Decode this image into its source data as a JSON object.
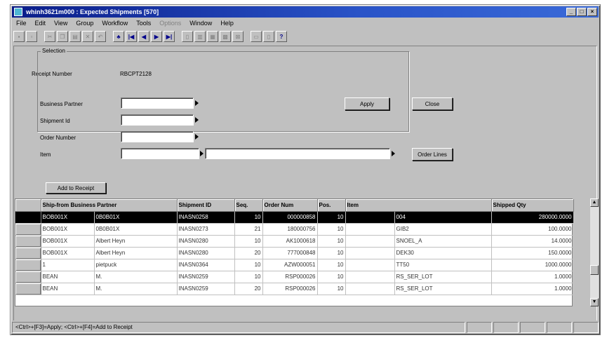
{
  "window": {
    "title": "whinh3621m000 : Expected Shipments [570]",
    "btn_min": "_",
    "btn_max": "□",
    "btn_close": "×"
  },
  "menu": {
    "file": "File",
    "edit": "Edit",
    "view": "View",
    "group": "Group",
    "workflow": "Workflow",
    "tools": "Tools",
    "disabled": "Options",
    "window": "Window",
    "help": "Help"
  },
  "form": {
    "receipt_label": "Receipt Number",
    "receipt_value": "RBCPT2128",
    "selection_label": "Selection",
    "bp_label": "Business Partner",
    "shipment_label": "Shipment Id",
    "order_label": "Order Number",
    "item_label": "Item",
    "apply": "Apply",
    "close": "Close",
    "order_lines": "Order Lines",
    "add_to_receipt": "Add to Receipt"
  },
  "grid": {
    "headers": {
      "bp": "Ship-from Business Partner",
      "shipment": "Shipment ID",
      "seq": "Seq.",
      "order": "Order Num",
      "pos": "Pos.",
      "item": "Item",
      "qty": "Shipped Qty"
    },
    "rows": [
      {
        "bp": "BOB001X",
        "bp_name": "0B0B01X",
        "shipment": "INASN0258",
        "seq": "10",
        "order": "000000858",
        "pos": "10",
        "item": "004",
        "qty": "280000.0000"
      },
      {
        "bp": "BOB001X",
        "bp_name": "0B0B01X",
        "shipment": "INASN0273",
        "seq": "21",
        "order": "180000756",
        "pos": "10",
        "item": "GIB2",
        "qty": "100.0000"
      },
      {
        "bp": "BOB001X",
        "bp_name": "Albert Heyn",
        "shipment": "INASN0280",
        "seq": "10",
        "order": "AK1000618",
        "pos": "10",
        "item": "SNOEL_A",
        "qty": "14.0000"
      },
      {
        "bp": "BOB001X",
        "bp_name": "Albert Heyn",
        "shipment": "INASN0280",
        "seq": "20",
        "order": "777000848",
        "pos": "10",
        "item": "DEK30",
        "qty": "150.0000"
      },
      {
        "bp": "1",
        "bp_name": "pietpuck",
        "shipment": "INASN0364",
        "seq": "10",
        "order": "AZW000051",
        "pos": "10",
        "item": "TT50",
        "qty": "1000.0000"
      },
      {
        "bp": "BEAN",
        "bp_name": "M.",
        "shipment": "INASN0259",
        "seq": "10",
        "order": "RSP000026",
        "pos": "10",
        "item": "RS_SER_LOT",
        "qty": "1.0000"
      },
      {
        "bp": "BEAN",
        "bp_name": "M.",
        "shipment": "INASN0259",
        "seq": "20",
        "order": "RSP000026",
        "pos": "10",
        "item": "RS_SER_LOT",
        "qty": "1.0000"
      }
    ]
  },
  "status": {
    "text": "<Ctrl>+[F3]=Apply; <Ctrl>+[F4]=Add to Receipt"
  },
  "toolbar_icons": [
    "save-icon",
    "print-icon",
    "cut-icon",
    "copy-icon",
    "paste-icon",
    "delete-icon",
    "find-icon",
    "first-record-icon",
    "prev-record-icon",
    "next-record-icon",
    "last-record-icon",
    "help-icon"
  ]
}
